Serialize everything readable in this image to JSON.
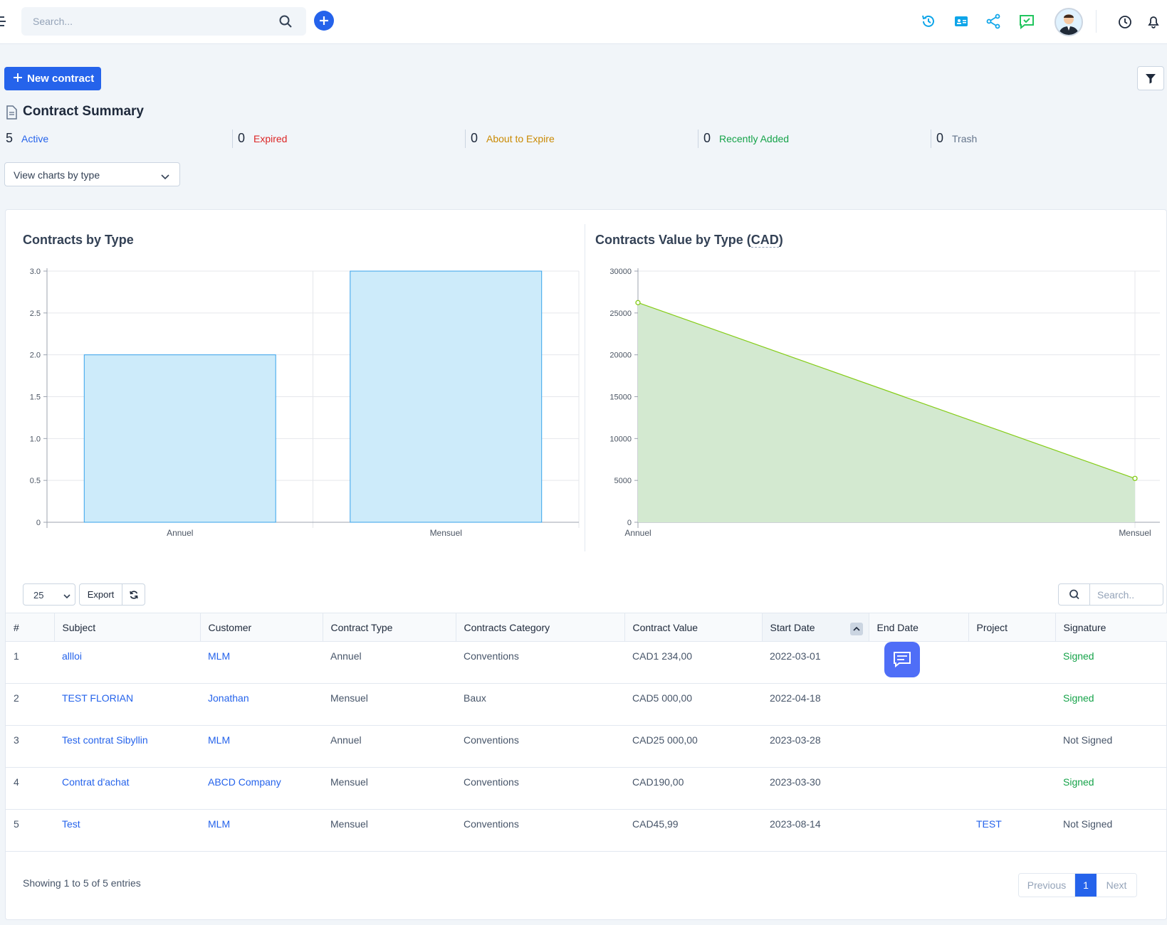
{
  "header": {
    "search_placeholder": "Search..."
  },
  "toolbar": {
    "new_contract_label": "New contract"
  },
  "summary": {
    "title": "Contract Summary",
    "stats": [
      {
        "count": "5",
        "label": "Active",
        "color": "#2563eb"
      },
      {
        "count": "0",
        "label": "Expired",
        "color": "#dc2626"
      },
      {
        "count": "0",
        "label": "About to Expire",
        "color": "#ca8a04"
      },
      {
        "count": "0",
        "label": "Recently Added",
        "color": "#16a34a"
      },
      {
        "count": "0",
        "label": "Trash",
        "color": "#64748b"
      }
    ],
    "view_select": "View charts by type"
  },
  "charts": {
    "left_title": "Contracts by Type",
    "right_title_prefix": "Contracts Value by Type (",
    "right_title_currency": "CAD",
    "right_title_suffix": ")"
  },
  "chart_data": [
    {
      "type": "bar",
      "title": "Contracts by Type",
      "categories": [
        "Annuel",
        "Mensuel"
      ],
      "values": [
        2,
        3
      ],
      "ylim": [
        0,
        3
      ],
      "yticks": [
        "0",
        "0.5",
        "1.0",
        "1.5",
        "2.0",
        "2.5",
        "3.0"
      ],
      "color": "#36a2eb",
      "fill": "#cdebfa",
      "grid": true
    },
    {
      "type": "area",
      "title": "Contracts Value by Type ( CAD)",
      "categories": [
        "Annuel",
        "Mensuel"
      ],
      "values": [
        26234,
        5236
      ],
      "ylim": [
        0,
        30000
      ],
      "yticks": [
        "0",
        "5000",
        "10000",
        "15000",
        "20000",
        "25000",
        "30000"
      ],
      "color": "#84cc16",
      "fill": "#d3e9d0",
      "grid": true
    }
  ],
  "table_controls": {
    "page_length": "25",
    "export_label": "Export",
    "search_placeholder": "Search.."
  },
  "table": {
    "columns": [
      "#",
      "Subject",
      "Customer",
      "Contract Type",
      "Contracts Category",
      "Contract Value",
      "Start Date",
      "End Date",
      "Project",
      "Signature"
    ],
    "rows": [
      {
        "num": "1",
        "subject": "allloi",
        "customer": "MLM",
        "type": "Annuel",
        "category": "Conventions",
        "value": "CAD1 234,00",
        "start": "2022-03-01",
        "end": "",
        "project": "",
        "signature": "Signed"
      },
      {
        "num": "2",
        "subject": "TEST FLORIAN",
        "customer": "Jonathan",
        "type": "Mensuel",
        "category": "Baux",
        "value": "CAD5 000,00",
        "start": "2022-04-18",
        "end": "",
        "project": "",
        "signature": "Signed"
      },
      {
        "num": "3",
        "subject": "Test contrat Sibyllin",
        "customer": "MLM",
        "type": "Annuel",
        "category": "Conventions",
        "value": "CAD25 000,00",
        "start": "2023-03-28",
        "end": "",
        "project": "",
        "signature": "Not Signed"
      },
      {
        "num": "4",
        "subject": "Contrat d'achat",
        "customer": "ABCD Company",
        "type": "Mensuel",
        "category": "Conventions",
        "value": "CAD190,00",
        "start": "2023-03-30",
        "end": "",
        "project": "",
        "signature": "Signed"
      },
      {
        "num": "5",
        "subject": "Test",
        "customer": "MLM",
        "type": "Mensuel",
        "category": "Conventions",
        "value": "CAD45,99",
        "start": "2023-08-14",
        "end": "",
        "project": "TEST",
        "signature": "Not Signed"
      }
    ]
  },
  "footer": {
    "info": "Showing 1 to 5 of 5 entries",
    "prev": "Previous",
    "page": "1",
    "next": "Next"
  }
}
